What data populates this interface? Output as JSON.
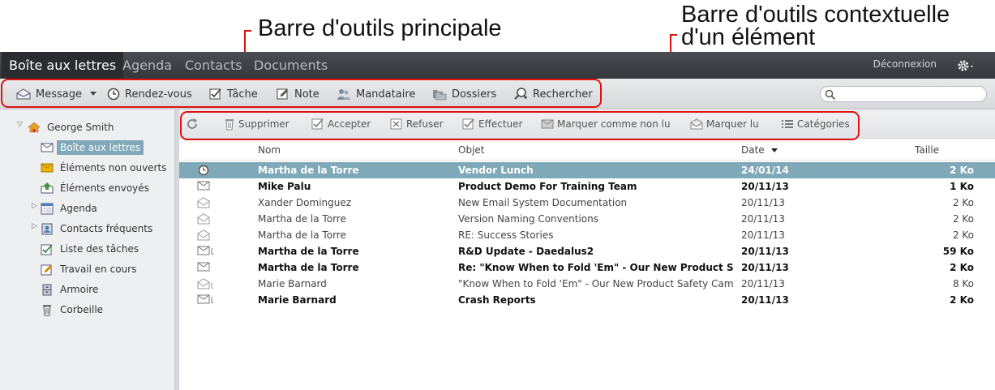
{
  "annotations": {
    "main_toolbar": "Barre d'outils principale",
    "context_toolbar_line1": "Barre d'outils contextuelle",
    "context_toolbar_line2": "d'un élément"
  },
  "nav": {
    "tabs": [
      "Boîte aux lettres",
      "Agenda",
      "Contacts",
      "Documents"
    ],
    "active_tab": "Boîte aux lettres",
    "logout": "Déconnexion"
  },
  "toolbar": {
    "message": "Message",
    "rendezvous": "Rendez-vous",
    "task": "Tâche",
    "note": "Note",
    "proxy": "Mandataire",
    "folders": "Dossiers",
    "find": "Rechercher"
  },
  "sidebar": {
    "user": "George Smith",
    "items": [
      {
        "label": "Boîte aux lettres",
        "icon": "mailbox-icon",
        "selected": true
      },
      {
        "label": "Éléments non ouverts",
        "icon": "envelope-closed-icon"
      },
      {
        "label": "Éléments envoyés",
        "icon": "sent-items-icon"
      },
      {
        "label": "Agenda",
        "icon": "calendar-icon",
        "expandable": true
      },
      {
        "label": "Contacts fréquents",
        "icon": "contacts-icon",
        "expandable": true
      },
      {
        "label": "Liste des tâches",
        "icon": "task-list-icon"
      },
      {
        "label": "Travail en cours",
        "icon": "work-in-progress-icon"
      },
      {
        "label": "Armoire",
        "icon": "cabinet-icon"
      },
      {
        "label": "Corbeille",
        "icon": "trash-icon"
      }
    ]
  },
  "context_toolbar": {
    "delete": "Supprimer",
    "accept": "Accepter",
    "decline": "Refuser",
    "complete": "Effectuer",
    "mark_unread": "Marquer comme non lu",
    "mark_read": "Marquer lu",
    "categories": "Catégories"
  },
  "grid": {
    "headers": {
      "from": "Nom",
      "subject": "Objet",
      "date": "Date",
      "size": "Taille"
    },
    "rows": [
      {
        "icon": "appointment-icon",
        "from": "Martha de la Torre",
        "subject": "Vendor Lunch",
        "date": "24/01/14",
        "size": "2 Ko",
        "state": "selected"
      },
      {
        "icon": "envelope-closed-icon",
        "from": "Mike Palu",
        "subject": "Product Demo For Training Team",
        "date": "20/11/13",
        "size": "1 Ko",
        "state": "unread"
      },
      {
        "icon": "envelope-open-icon",
        "from": "Xander Dominguez",
        "subject": "New Email System Documentation",
        "date": "20/11/13",
        "size": "2 Ko",
        "state": "read"
      },
      {
        "icon": "envelope-open-icon",
        "from": "Martha de la Torre",
        "subject": "Version Naming Conventions",
        "date": "20/11/13",
        "size": "2 Ko",
        "state": "read"
      },
      {
        "icon": "envelope-open-icon",
        "from": "Martha de la Torre",
        "subject": "RE: Success Stories",
        "date": "20/11/13",
        "size": "2 Ko",
        "state": "read"
      },
      {
        "icon": "envelope-attachment-icon",
        "from": "Martha de la Torre",
        "subject": "R&D Update - Daedalus2",
        "date": "20/11/13",
        "size": "59 Ko",
        "state": "unread"
      },
      {
        "icon": "envelope-closed-icon",
        "from": "Martha de la Torre",
        "subject": "Re: \"Know When to Fold 'Em\" - Our New Product Safety",
        "date": "20/11/13",
        "size": "2 Ko",
        "state": "unread"
      },
      {
        "icon": "envelope-open-attachment-icon",
        "from": "Marie Barnard",
        "subject": "\"Know When to Fold 'Em\" - Our New Product Safety Campa",
        "date": "20/11/13",
        "size": "8 Ko",
        "state": "read"
      },
      {
        "icon": "envelope-attachment-icon",
        "from": "Marie Barnard",
        "subject": "Crash Reports",
        "date": "20/11/13",
        "size": "2 Ko",
        "state": "unread"
      }
    ]
  },
  "colors": {
    "annotation": "#d11111",
    "selection": "#7fa8b8",
    "topnav": "#3a3d41"
  }
}
